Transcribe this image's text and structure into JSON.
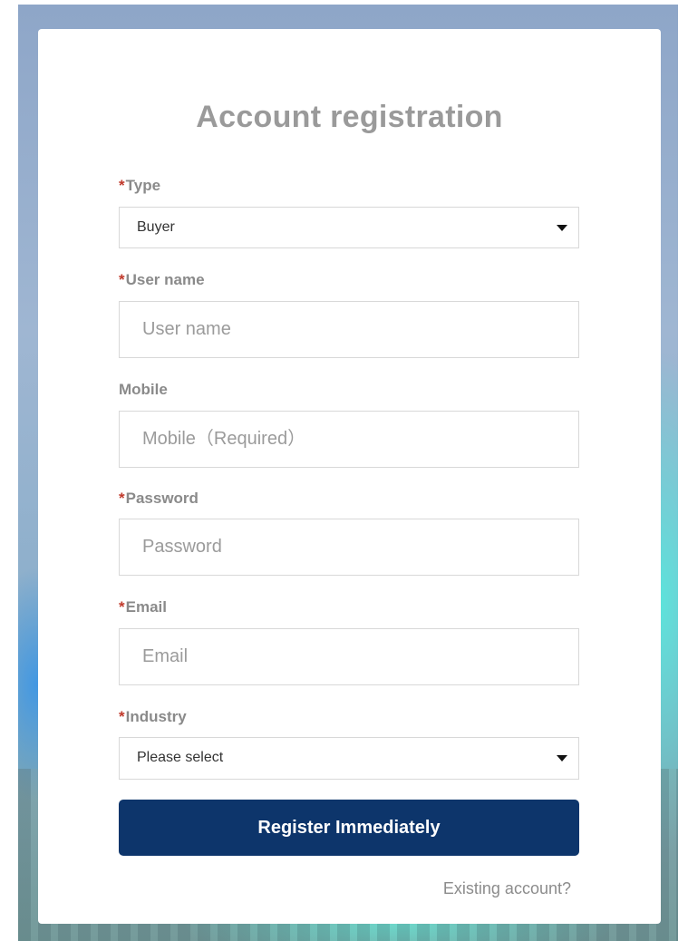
{
  "title": "Account registration",
  "required_mark": "*",
  "fields": {
    "type": {
      "label": "Type",
      "value": "Buyer"
    },
    "username": {
      "label": "User name",
      "placeholder": "User name"
    },
    "mobile": {
      "label": "Mobile",
      "placeholder": "Mobile（Required）"
    },
    "password": {
      "label": "Password",
      "placeholder": "Password"
    },
    "email": {
      "label": "Email",
      "placeholder": "Email"
    },
    "industry": {
      "label": "Industry",
      "value": "Please select"
    }
  },
  "submit_label": "Register Immediately",
  "existing_account_link": "Existing account?",
  "colors": {
    "primary_button": "#0d356b",
    "required_mark": "#c0392b",
    "label_text": "#8a8a8a",
    "title_text": "#9a9a9a"
  },
  "icons": {
    "dropdown": "caret-down-icon"
  }
}
